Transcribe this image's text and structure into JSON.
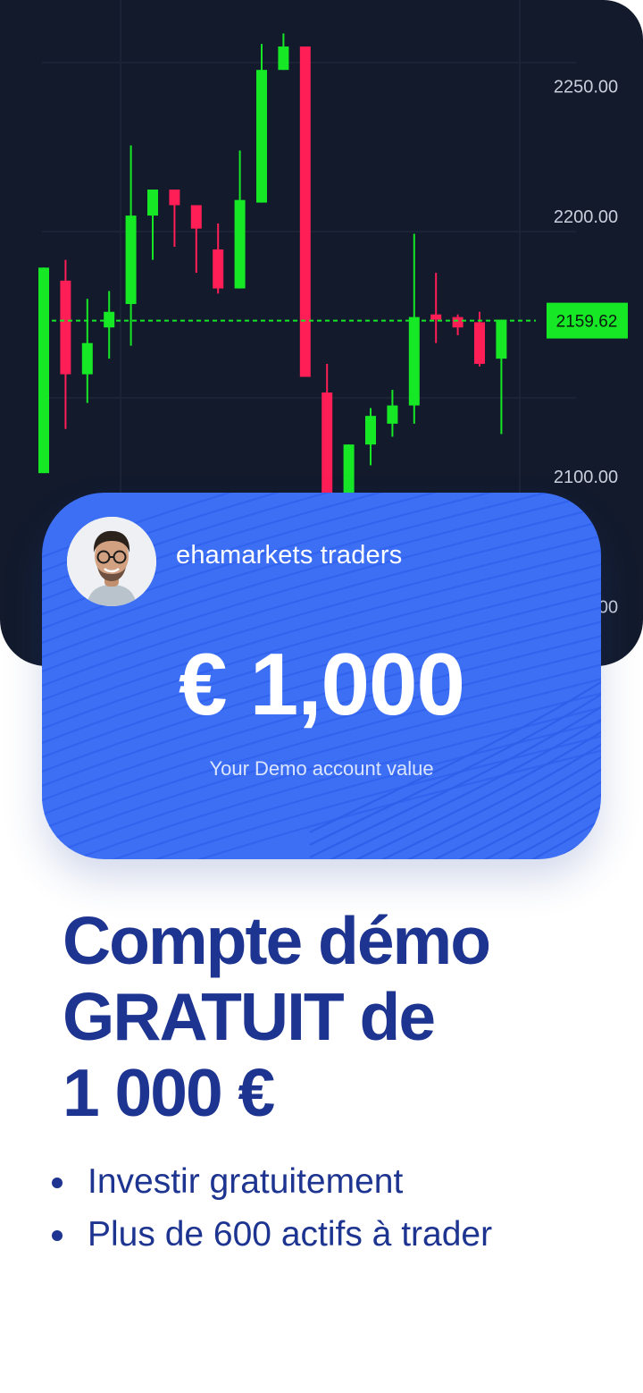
{
  "chart": {
    "price_levels": [
      "2250.00",
      "2200.00",
      "2100.00",
      "2050.00"
    ],
    "current_price": "2159.62",
    "up_color": "#17e826",
    "down_color": "#ff1e55",
    "background_color": "#121a2c"
  },
  "chart_data": {
    "type": "candlestick",
    "ylim": [
      2044,
      2276
    ],
    "price_line": 2159.62,
    "y_ticks": [
      2250,
      2200,
      2100,
      2050
    ],
    "candles": [
      {
        "open": 2101,
        "high": 2180,
        "low": 2101,
        "close": 2180
      },
      {
        "open": 2175,
        "high": 2183,
        "low": 2118,
        "close": 2139
      },
      {
        "open": 2139,
        "high": 2168,
        "low": 2128,
        "close": 2151
      },
      {
        "open": 2157,
        "high": 2171,
        "low": 2145,
        "close": 2163
      },
      {
        "open": 2166,
        "high": 2227,
        "low": 2150,
        "close": 2200
      },
      {
        "open": 2200,
        "high": 2205,
        "low": 2183,
        "close": 2210
      },
      {
        "open": 2210,
        "high": 2203,
        "low": 2188,
        "close": 2204
      },
      {
        "open": 2204,
        "high": 2201,
        "low": 2178,
        "close": 2195
      },
      {
        "open": 2187,
        "high": 2197,
        "low": 2170,
        "close": 2172
      },
      {
        "open": 2172,
        "high": 2225,
        "low": 2172,
        "close": 2206
      },
      {
        "open": 2205,
        "high": 2266,
        "low": 2205,
        "close": 2256
      },
      {
        "open": 2256,
        "high": 2270,
        "low": 2256,
        "close": 2265
      },
      {
        "open": 2265,
        "high": 2265,
        "low": 2138,
        "close": 2138
      },
      {
        "open": 2132,
        "high": 2143,
        "low": 2081,
        "close": 2081
      },
      {
        "open": 2081,
        "high": 2090,
        "low": 2081,
        "close": 2112
      },
      {
        "open": 2112,
        "high": 2126,
        "low": 2104,
        "close": 2123
      },
      {
        "open": 2120,
        "high": 2133,
        "low": 2115,
        "close": 2127
      },
      {
        "open": 2127,
        "high": 2193,
        "low": 2120,
        "close": 2161
      },
      {
        "open": 2162,
        "high": 2178,
        "low": 2151,
        "close": 2160
      },
      {
        "open": 2161,
        "high": 2162,
        "low": 2154,
        "close": 2157
      },
      {
        "open": 2159,
        "high": 2163,
        "low": 2142,
        "close": 2143
      },
      {
        "open": 2145,
        "high": 2160,
        "low": 2116,
        "close": 2160
      }
    ]
  },
  "card": {
    "name": "ehamarkets traders",
    "amount": "€ 1,000",
    "caption": "Your Demo account value"
  },
  "headline": {
    "line1": "Compte démo",
    "line2": "GRATUIT de",
    "line3": "1 000 €"
  },
  "bullets": [
    "Investir gratuitement",
    "Plus de 600 actifs à trader"
  ]
}
